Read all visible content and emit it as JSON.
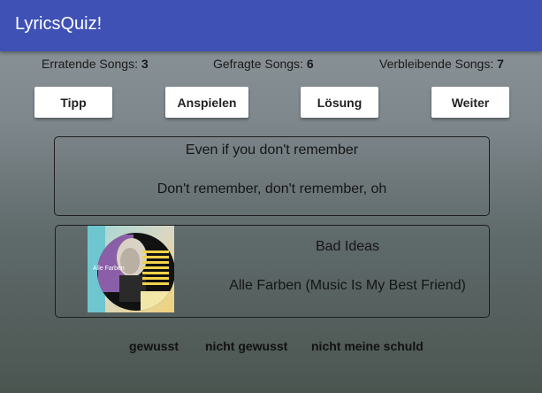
{
  "app": {
    "title": "LyricsQuiz!"
  },
  "stats": {
    "guessed_label": "Erratende Songs:",
    "guessed_value": "3",
    "asked_label": "Gefragte Songs:",
    "asked_value": "6",
    "remaining_label": "Verbleibende Songs:",
    "remaining_value": "7"
  },
  "buttons": {
    "hint": "Tipp",
    "play": "Anspielen",
    "solution": "Lösung",
    "next": "Weiter"
  },
  "lyrics": {
    "line1": "Even if you don't remember",
    "line2": "Don't remember, don't remember, oh"
  },
  "song": {
    "title": "Bad Ideas",
    "artist": "Alle Farben (Music Is My Best Friend)",
    "cover_text": "Alle Farben"
  },
  "rating": {
    "known": "gewusst",
    "unknown": "nicht gewusst",
    "not_my_fault": "nicht meine schuld"
  }
}
